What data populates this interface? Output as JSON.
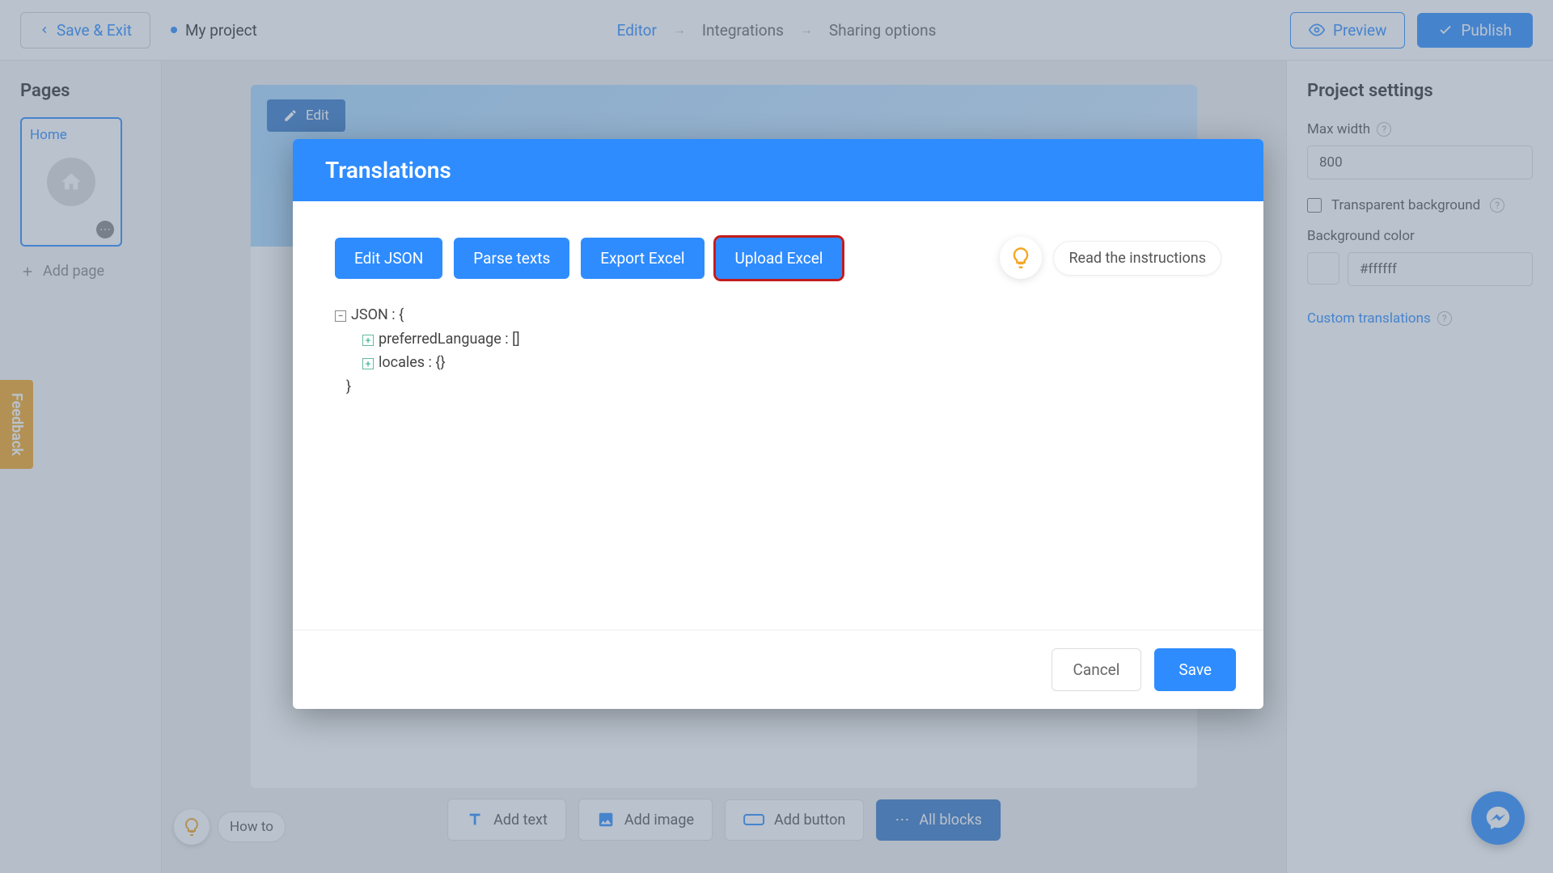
{
  "topbar": {
    "save_exit": "Save & Exit",
    "project_name": "My project",
    "nav": {
      "editor": "Editor",
      "integrations": "Integrations",
      "sharing": "Sharing options"
    },
    "preview": "Preview",
    "publish": "Publish"
  },
  "sidebar_left": {
    "title": "Pages",
    "page_home": "Home",
    "add_page": "Add page"
  },
  "canvas": {
    "edit": "Edit",
    "toolbar": {
      "add_text": "Add text",
      "add_image": "Add image",
      "add_button": "Add button",
      "all_blocks": "All blocks"
    },
    "howto": "How to"
  },
  "sidebar_right": {
    "title": "Project settings",
    "max_width_label": "Max width",
    "max_width_value": "800",
    "transparent_bg": "Transparent background",
    "bg_color_label": "Background color",
    "bg_color_value": "#ffffff",
    "custom_translations": "Custom translations"
  },
  "modal": {
    "title": "Translations",
    "buttons": {
      "edit_json": "Edit JSON",
      "parse_texts": "Parse texts",
      "export_excel": "Export Excel",
      "upload_excel": "Upload Excel"
    },
    "instructions": "Read the instructions",
    "json": {
      "root": "JSON : {",
      "preferred_language": "preferredLanguage : []",
      "locales": "locales : {}",
      "close": "}"
    },
    "cancel": "Cancel",
    "save": "Save"
  },
  "feedback": "Feedback"
}
